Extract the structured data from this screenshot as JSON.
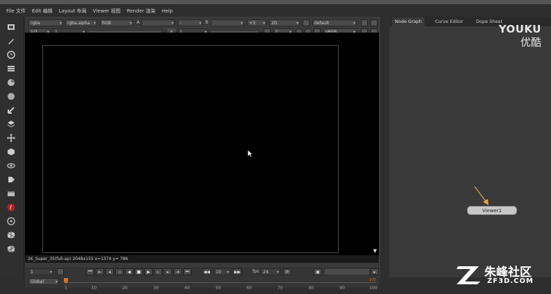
{
  "menu": [
    "File 文件",
    "Edit 编辑",
    "Layout 布局",
    "Viewer 视图",
    "Render 渲染",
    "Help"
  ],
  "viewer_controls": {
    "row1": {
      "channels": "rgba",
      "layer": "rgba.alpha",
      "display": "RGB",
      "input_a_label": "A",
      "input_a_op": "-",
      "input_b_label": "B",
      "zoom": "+3",
      "view_mode": "2D",
      "lut": "default"
    },
    "row2": {
      "frame_ratio": "1/3",
      "gain_value": "1",
      "gamma_label": "y",
      "gamma_value": "1",
      "proxy": "1",
      "colorspace": "sRGB"
    }
  },
  "viewport": {
    "status": "2K_Super_35(full-ap) 2048x155  x=1374 y= 786"
  },
  "timeline": {
    "current_frame": "1",
    "skip_value": "10",
    "fps_label": "fps",
    "fps_value": "24",
    "range_mode": "Global",
    "ticks": [
      "1",
      "10",
      "20",
      "30",
      "40",
      "50",
      "60",
      "70",
      "80",
      "90",
      "100"
    ],
    "end_frame": "100"
  },
  "right_panel": {
    "tabs": [
      "Node Graph",
      "Curve Editor",
      "Dope Sheet"
    ],
    "active_tab": "Node Graph",
    "node_label": "Viewer1"
  },
  "watermarks": {
    "youku_line1": "YOUKU",
    "youku_line2": "优酷",
    "site_name": "朱峰社区",
    "site_domain": "ZF3D.COM"
  },
  "colors": {
    "panel_bg": "#3a3a3a",
    "viewport_bg": "#000000",
    "node_fill": "#c7c7c7",
    "arrow": "#e6a23c"
  },
  "icons": {
    "left_toolbar": [
      "image-icon",
      "draw-icon",
      "time-icon",
      "channel-icon",
      "color-icon",
      "filter-icon",
      "keyer-icon",
      "merge-icon",
      "transform-icon",
      "3d-icon",
      "views-icon",
      "metadata-icon",
      "toolsets-icon",
      "furnace-icon",
      "other-icon",
      "plugin-icon",
      "misc-icon"
    ]
  }
}
